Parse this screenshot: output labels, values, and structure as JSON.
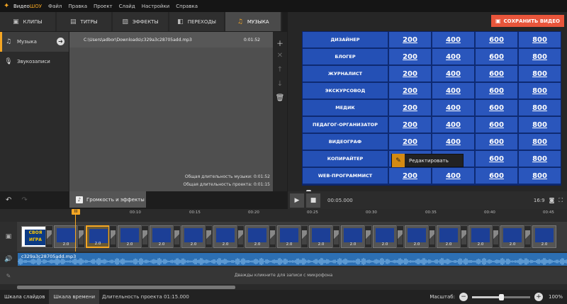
{
  "app": {
    "name_a": "Видео",
    "name_b": "ШОУ"
  },
  "menu": [
    "Файл",
    "Правка",
    "Проект",
    "Слайд",
    "Настройки",
    "Справка"
  ],
  "tabs": [
    {
      "label": "КЛИПЫ",
      "icon": "film-icon"
    },
    {
      "label": "ТИТРЫ",
      "icon": "speech-bubble-icon"
    },
    {
      "label": "ЭФФЕКТЫ",
      "icon": "effects-icon"
    },
    {
      "label": "ПЕРЕХОДЫ",
      "icon": "transition-icon"
    },
    {
      "label": "МУЗЫКА",
      "icon": "music-note-icon"
    }
  ],
  "sidebar": {
    "items": [
      {
        "label": "Музыка",
        "icon": "music-note-icon",
        "active": true
      },
      {
        "label": "Звукозаписи",
        "icon": "microphone-icon",
        "active": false
      }
    ]
  },
  "music": {
    "track": {
      "path": "C:\\Users\\adbor\\Downloads\\c329a3c28705add.mp3",
      "duration": "0:01:52"
    },
    "total_music": "Общая длительность музыки: 0:01:52",
    "total_project": "Общая длительность проекта: 0:01:15"
  },
  "export_label": "СОХРАНИТЬ ВИДЕО",
  "game": {
    "rows": [
      "ДИЗАЙНЕР",
      "БЛОГЕР",
      "ЖУРНАЛИСТ",
      "ЭКСКУРСОВОД",
      "МЕДИК",
      "ПЕДАГОГ-ОРГАНИЗАТОР",
      "ВИДЕОГРАФ",
      "КОПИРАЙТЕР",
      "WEB-ПРОГРАММИСТ"
    ],
    "values": [
      "200",
      "400",
      "600",
      "800"
    ]
  },
  "context_menu": {
    "label": "Редактировать"
  },
  "volume_button": "Громкость и эффекты",
  "player": {
    "time": "00:05.000",
    "ratio": "16:9",
    "progress": 0.04
  },
  "ruler": [
    "00:10",
    "00:15",
    "00:20",
    "00:25",
    "00:30",
    "00:35",
    "00:40",
    "00:45"
  ],
  "playhead_label": "III",
  "timeline": {
    "logo_clip": "СВОЯ ИГРА",
    "clip_durations": [
      "2.0",
      "2.0",
      "2.0",
      "2.0",
      "2.0",
      "2.0",
      "2.0",
      "2.0",
      "2.0",
      "2.0",
      "2.0",
      "2.0",
      "2.0",
      "2.0",
      "2.0",
      "2.0"
    ],
    "audio_name": "c329a3c28705add.mp3",
    "mic_hint": "Дважды кликните для записи с микрофона"
  },
  "status": {
    "slides_tab": "Шкала слайдов",
    "time_tab": "Шкала времени",
    "duration": "Длительность проекта 01:15.000",
    "scale_label": "Масштаб:",
    "zoom": "100%"
  }
}
